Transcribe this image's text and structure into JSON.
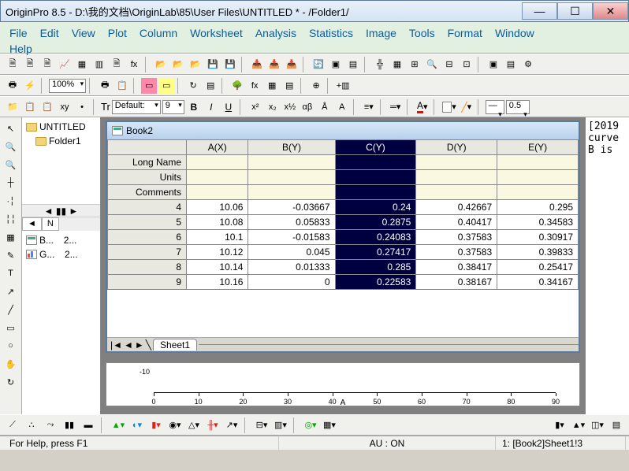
{
  "window": {
    "title": "OriginPro 8.5 - D:\\我的文档\\OriginLab\\85\\User Files\\UNTITLED * - /Folder1/"
  },
  "menubar": [
    "File",
    "Edit",
    "View",
    "Plot",
    "Column",
    "Worksheet",
    "Analysis",
    "Statistics",
    "Image",
    "Tools",
    "Format",
    "Window",
    "Help"
  ],
  "toolbar2": {
    "zoom": "100%",
    "font": "Default:",
    "fontsize": "9",
    "linewidth": "0.5"
  },
  "folder": {
    "root": "UNTITLED",
    "child": "Folder1",
    "tab": "N",
    "items": [
      {
        "name": "B...",
        "num": "2..."
      },
      {
        "name": "G...",
        "num": "2..."
      }
    ]
  },
  "workbook": {
    "title": "Book2",
    "columns": [
      "A(X)",
      "B(Y)",
      "C(Y)",
      "D(Y)",
      "E(Y)"
    ],
    "selectedCol": 2,
    "metaRows": [
      "Long Name",
      "Units",
      "Comments"
    ],
    "rows": [
      {
        "i": "4",
        "c": [
          "10.06",
          "-0.03667",
          "0.24",
          "0.42667",
          "0.295"
        ]
      },
      {
        "i": "5",
        "c": [
          "10.08",
          "0.05833",
          "0.2875",
          "0.40417",
          "0.34583"
        ]
      },
      {
        "i": "6",
        "c": [
          "10.1",
          "-0.01583",
          "0.24083",
          "0.37583",
          "0.30917"
        ]
      },
      {
        "i": "7",
        "c": [
          "10.12",
          "0.045",
          "0.27417",
          "0.37583",
          "0.39833"
        ]
      },
      {
        "i": "8",
        "c": [
          "10.14",
          "0.01333",
          "0.285",
          "0.38417",
          "0.25417"
        ]
      },
      {
        "i": "9",
        "c": [
          "10.16",
          "0",
          "0.22583",
          "0.38167",
          "0.34167"
        ]
      }
    ],
    "sheetTab": "Sheet1"
  },
  "graph": {
    "ylabel": "-10",
    "xlabel": "A",
    "ticks": [
      "0",
      "10",
      "20",
      "30",
      "40",
      "50",
      "60",
      "70",
      "80",
      "90"
    ]
  },
  "chart_data": {
    "type": "line",
    "title": "",
    "xlabel": "A",
    "ylabel": "",
    "xlim": [
      0,
      90
    ],
    "xticks": [
      0,
      10,
      20,
      30,
      40,
      50,
      60,
      70,
      80,
      90
    ],
    "ylim": [
      -10,
      null
    ],
    "series": []
  },
  "rightPanel": "[2019\ncurve\nB is",
  "status": {
    "help": "For Help, press F1",
    "au": "AU : ON",
    "sel": "1: [Book2]Sheet1!3"
  }
}
